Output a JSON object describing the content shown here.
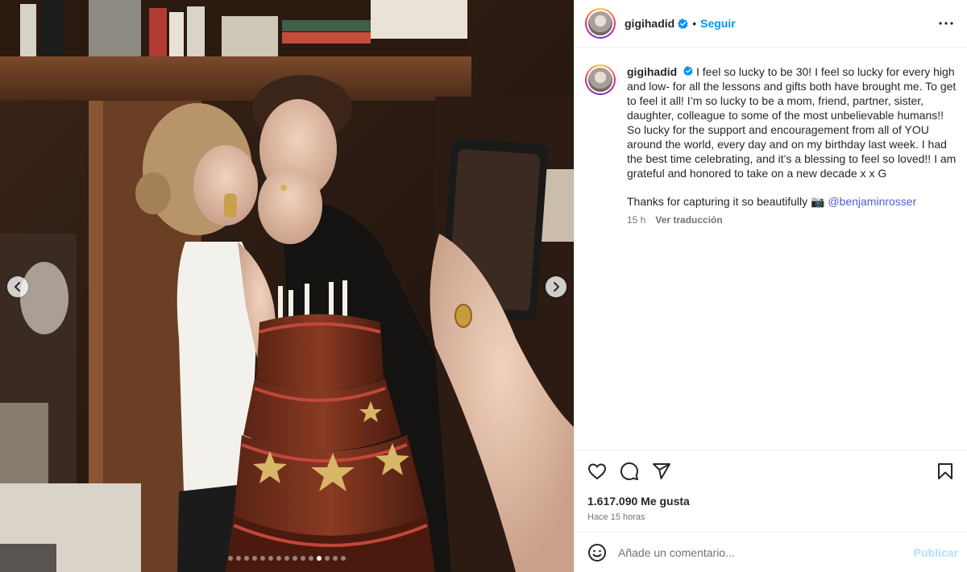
{
  "post": {
    "username": "gigihadid",
    "verified": true,
    "follow_label": "Seguir",
    "separator": "•",
    "more_icon": "more-options-icon"
  },
  "caption": {
    "username": "gigihadid",
    "text": "I feel so lucky to be 30! I feel so lucky for every high and low- for all the lessons and gifts both have brought me. To get to feel it all! I’m so lucky to be a mom, friend, partner, sister, daughter, colleague to some of the most unbelievable humans!! So lucky for the support and encouragement from all of YOU around the world, every day and on my birthday last week. I had the best time celebrating, and it’s a blessing to feel so loved!! I am grateful and honored to take on a new decade x x G",
    "thanks_text": "Thanks for capturing it so beautifully 📷 ",
    "mention": "@benjaminrosser",
    "age": "15 h",
    "see_translation": "Ver traducción"
  },
  "carousel": {
    "total": 15,
    "active_index": 11
  },
  "actions": {
    "like_icon": "heart-icon",
    "comment_icon": "comment-icon",
    "share_icon": "share-icon",
    "save_icon": "bookmark-icon"
  },
  "likes": "1.617.090 Me gusta",
  "posted_time": "Hace 15 horas",
  "comment": {
    "placeholder": "Añade un comentario...",
    "publish_label": "Publicar"
  },
  "colors": {
    "accent": "#0095f6",
    "publish_disabled": "#b2dffc",
    "mention": "#4f5bd5",
    "secondary_text": "#737373"
  }
}
